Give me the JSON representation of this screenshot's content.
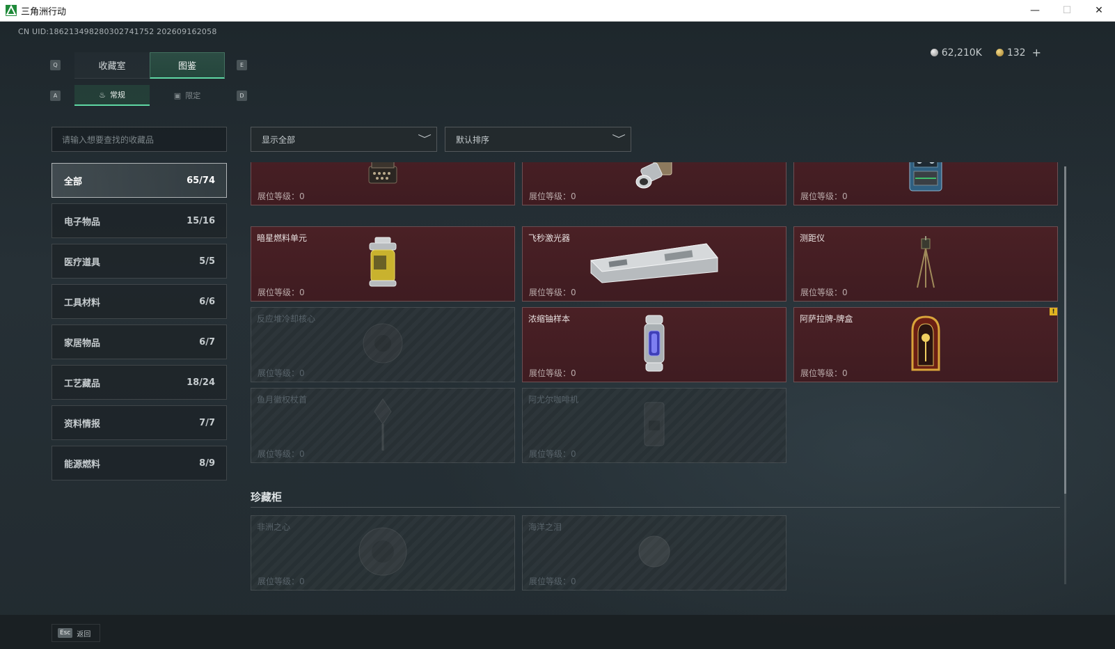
{
  "window": {
    "title": "三角洲行动",
    "minimize": "—",
    "maximize": "☐",
    "close": "✕"
  },
  "header": {
    "uid": "CN UID:186213498280302741752 202609162058",
    "currency_silver": "62,210K",
    "currency_gold": "132",
    "plus": "+"
  },
  "keys": {
    "q": "Q",
    "e": "E",
    "a": "A",
    "d": "D"
  },
  "tabs": [
    {
      "label": "收藏室",
      "active": false
    },
    {
      "label": "图鉴",
      "active": true
    }
  ],
  "subtabs": [
    {
      "label": "常规",
      "icon": "bottle-icon",
      "glyph": "♨",
      "active": true
    },
    {
      "label": "限定",
      "icon": "image-icon",
      "glyph": "▣",
      "active": false
    }
  ],
  "search": {
    "placeholder": "请输入想要查找的收藏品"
  },
  "categories": [
    {
      "label": "全部",
      "count": "65/74",
      "active": true
    },
    {
      "label": "电子物品",
      "count": "15/16",
      "active": false
    },
    {
      "label": "医疗道具",
      "count": "5/5",
      "active": false
    },
    {
      "label": "工具材料",
      "count": "6/6",
      "active": false
    },
    {
      "label": "家居物品",
      "count": "6/7",
      "active": false
    },
    {
      "label": "工艺藏品",
      "count": "18/24",
      "active": false
    },
    {
      "label": "资料情报",
      "count": "7/7",
      "active": false
    },
    {
      "label": "能源燃料",
      "count": "8/9",
      "active": false
    }
  ],
  "filters": {
    "show": "显示全部",
    "sort": "默认排序",
    "chevron": "﹀"
  },
  "level_label": "展位等级：0",
  "cards": [
    {
      "name": "",
      "icon": "typewriter-icon",
      "locked": false
    },
    {
      "name": "",
      "icon": "camera-lens-icon",
      "locked": false
    },
    {
      "name": "",
      "icon": "machine-icon",
      "locked": false
    },
    {
      "name": "暗星燃料单元",
      "icon": "fuel-canister-icon",
      "locked": false
    },
    {
      "name": "飞秒激光器",
      "icon": "laser-case-icon",
      "locked": false
    },
    {
      "name": "测距仪",
      "icon": "tripod-icon",
      "locked": false
    },
    {
      "name": "反应堆冷却核心",
      "icon": "reactor-core-icon",
      "locked": true
    },
    {
      "name": "浓缩铀样本",
      "icon": "uranium-capsule-icon",
      "locked": false
    },
    {
      "name": "阿萨拉牌-牌盒",
      "icon": "card-box-icon",
      "locked": false,
      "warn": "!"
    },
    {
      "name": "鱼月徽权杖首",
      "icon": "scepter-icon",
      "locked": true
    },
    {
      "name": "阿尤尔咖啡机",
      "icon": "coffee-machine-icon",
      "locked": true
    }
  ],
  "treasure": {
    "title": "珍藏柜",
    "cards": [
      {
        "name": "非洲之心",
        "icon": "gem-icon",
        "locked": true
      },
      {
        "name": "海洋之泪",
        "icon": "pearl-icon",
        "locked": true
      }
    ]
  },
  "footer": {
    "esc_key": "Esc",
    "esc_label": "返回"
  }
}
